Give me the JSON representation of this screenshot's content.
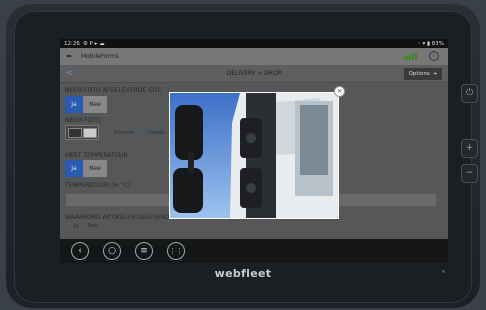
{
  "statusbar": {
    "time": "12:26",
    "left_icons": "⚙ P ▸ ☁",
    "right_text": "◦ ▾ ▮ 83%"
  },
  "app": {
    "title": "MobileForms",
    "info": "i"
  },
  "nav": {
    "breadcrumb": "DELIVERY > DROP",
    "options_label": "Options",
    "options_plus": "+"
  },
  "form": {
    "q1_label": "NEEM FOTO AFGELEVERDE GOE",
    "ja": "Ja",
    "nee": "Nee",
    "q2_label": "NEEM FOTO",
    "preview": "Preview",
    "delete": "Delete",
    "q3_label": "MEET TEMPERATUUR",
    "q4_label": "TEMPERATUUR (in °C)",
    "q5_label": "WAARBORG ARTIKELEN GELEVERD",
    "q5_ja": "Ja",
    "q5_nee": "Nee"
  },
  "overlay": {
    "close": "×"
  },
  "navkeys": {
    "back": "‹",
    "home": "○",
    "menu": "≡",
    "apps": "⋮⋮"
  },
  "device": {
    "brand": "webfleet",
    "btn_plus": "+",
    "btn_minus": "−",
    "btn_power": "⏻"
  }
}
